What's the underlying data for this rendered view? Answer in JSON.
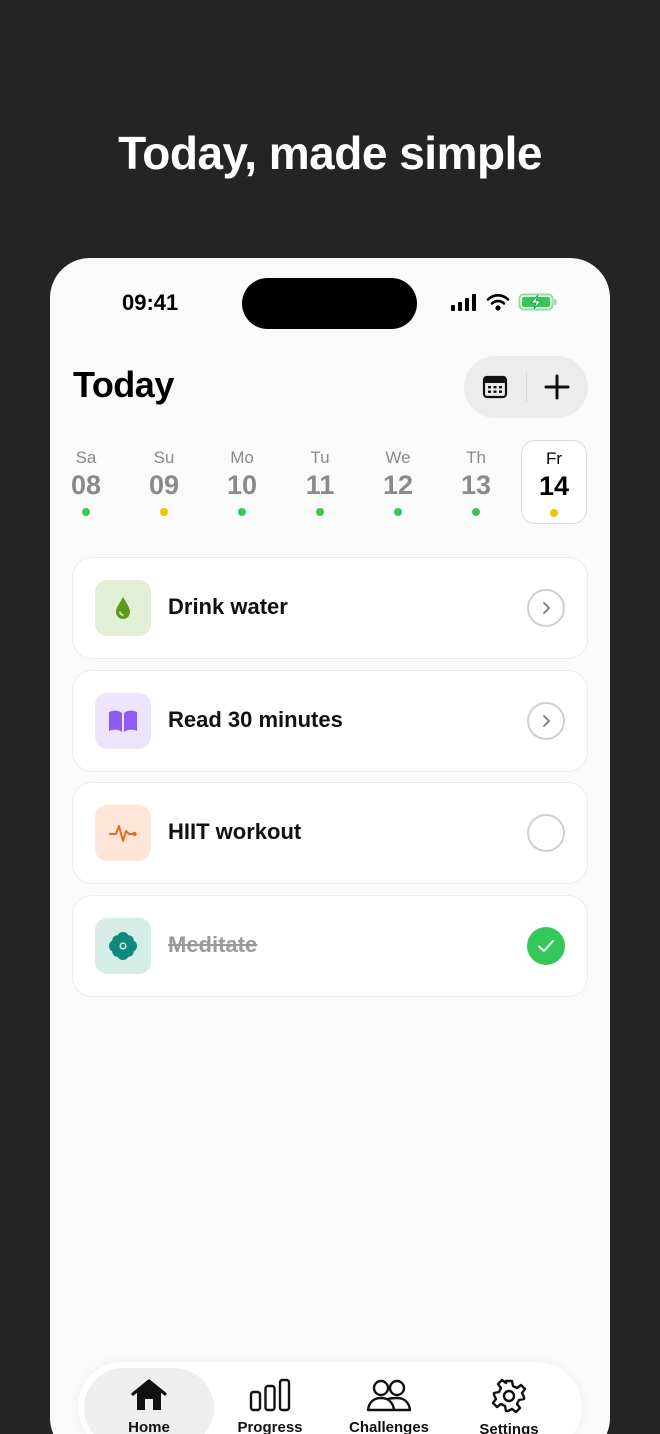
{
  "headline": "Today, made simple",
  "status_bar": {
    "time": "09:41",
    "icons": [
      "cellular-signal-icon",
      "wifi-icon",
      "battery-charging-icon"
    ]
  },
  "header": {
    "title": "Today",
    "calendar_icon": "calendar-icon",
    "add_icon": "plus-icon"
  },
  "days": [
    {
      "name": "Sa",
      "num": "08",
      "dot_color": "#34c759",
      "selected": false
    },
    {
      "name": "Su",
      "num": "09",
      "dot_color": "#f5c400",
      "selected": false
    },
    {
      "name": "Mo",
      "num": "10",
      "dot_color": "#34c759",
      "selected": false
    },
    {
      "name": "Tu",
      "num": "11",
      "dot_color": "#34c759",
      "selected": false
    },
    {
      "name": "We",
      "num": "12",
      "dot_color": "#34c759",
      "selected": false
    },
    {
      "name": "Th",
      "num": "13",
      "dot_color": "#34c759",
      "selected": false
    },
    {
      "name": "Fr",
      "num": "14",
      "dot_color": "#f5c400",
      "selected": true
    }
  ],
  "habits": [
    {
      "label": "Drink water",
      "icon": "water-drop-icon",
      "icon_bg": "#e3eed6",
      "icon_color": "#5c9a1a",
      "state": "chevron",
      "done": false
    },
    {
      "label": "Read 30 minutes",
      "icon": "book-icon",
      "icon_bg": "#ece4fb",
      "icon_color": "#8b5cf6",
      "state": "chevron",
      "done": false
    },
    {
      "label": "HIIT workout",
      "icon": "heartbeat-icon",
      "icon_bg": "#fde6d8",
      "icon_color": "#ea6a1f",
      "state": "empty",
      "done": false
    },
    {
      "label": "Meditate",
      "icon": "flower-icon",
      "icon_bg": "#d5ece7",
      "icon_color": "#0f8a7a",
      "state": "checked",
      "done": true
    }
  ],
  "tabbar": {
    "tabs": [
      {
        "label": "Home",
        "icon": "home-icon",
        "active": true
      },
      {
        "label": "Progress",
        "icon": "bar-chart-icon",
        "active": false
      },
      {
        "label": "Challenges",
        "icon": "people-icon",
        "active": false
      },
      {
        "label": "Settings",
        "icon": "gear-icon",
        "active": false
      }
    ]
  },
  "colors": {
    "background": "#242424",
    "accent_green": "#34c759",
    "accent_yellow": "#f5c400"
  }
}
